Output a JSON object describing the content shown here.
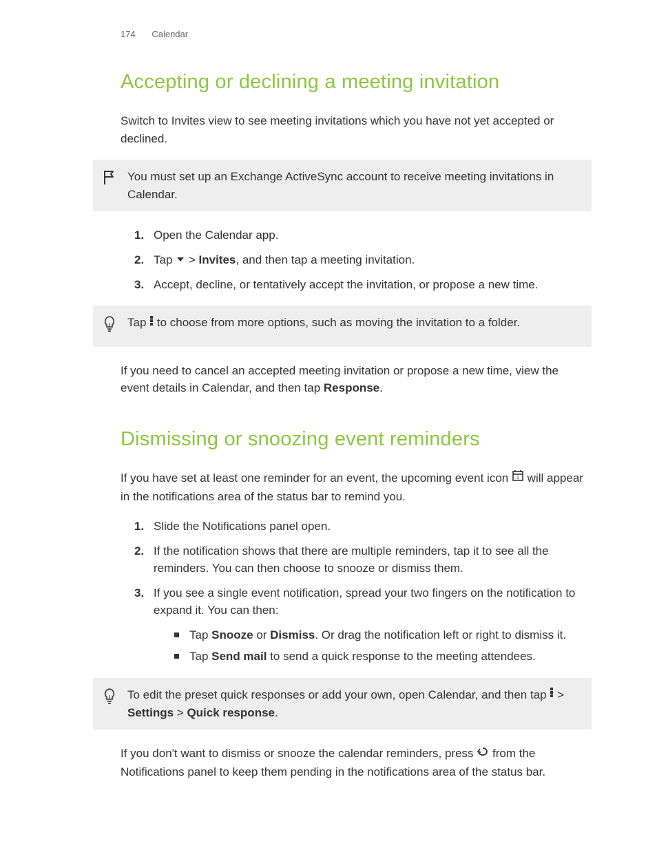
{
  "header": {
    "page_num": "174",
    "section": "Calendar"
  },
  "section1": {
    "title": "Accepting or declining a meeting invitation",
    "intro": "Switch to Invites view to see meeting invitations which you have not yet accepted or declined.",
    "note": "You must set up an Exchange ActiveSync account to receive meeting invitations in Calendar.",
    "steps": {
      "s1": "Open the Calendar app.",
      "s2_a": "Tap ",
      "s2_b": " > ",
      "s2_invites": "Invites",
      "s2_c": ", and then tap a meeting invitation.",
      "s3": "Accept, decline, or tentatively accept the invitation, or propose a new time."
    },
    "tip_a": "Tap ",
    "tip_b": " to choose from more options, such as moving the invitation to a folder.",
    "closing_a": "If you need to cancel an accepted meeting invitation or propose a new time, view the event details in Calendar, and then tap ",
    "closing_bold": "Response",
    "closing_b": "."
  },
  "section2": {
    "title": "Dismissing or snoozing event reminders",
    "intro_a": "If you have set at least one reminder for an event, the upcoming event icon ",
    "intro_b": " will appear in the notifications area of the status bar to remind you.",
    "steps": {
      "s1": "Slide the Notifications panel open.",
      "s2": "If the notification shows that there are multiple reminders, tap it to see all the reminders. You can then choose to snooze or dismiss them.",
      "s3": "If you see a single event notification, spread your two fingers on the notification to expand it. You can then:",
      "b1_a": "Tap ",
      "b1_snooze": "Snooze",
      "b1_b": " or ",
      "b1_dismiss": "Dismiss",
      "b1_c": ". Or drag the notification left or right to dismiss it.",
      "b2_a": "Tap ",
      "b2_send": "Send mail",
      "b2_b": " to send a quick response to the meeting attendees."
    },
    "tip_a": "To edit the preset quick responses or add your own, open Calendar, and then tap ",
    "tip_b": " > ",
    "tip_settings": "Settings",
    "tip_c": " > ",
    "tip_quick": "Quick response",
    "tip_d": ".",
    "closing_a": "If you don't want to dismiss or snooze the calendar reminders, press ",
    "closing_b": " from the Notifications panel to keep them pending in the notifications area of the status bar."
  }
}
